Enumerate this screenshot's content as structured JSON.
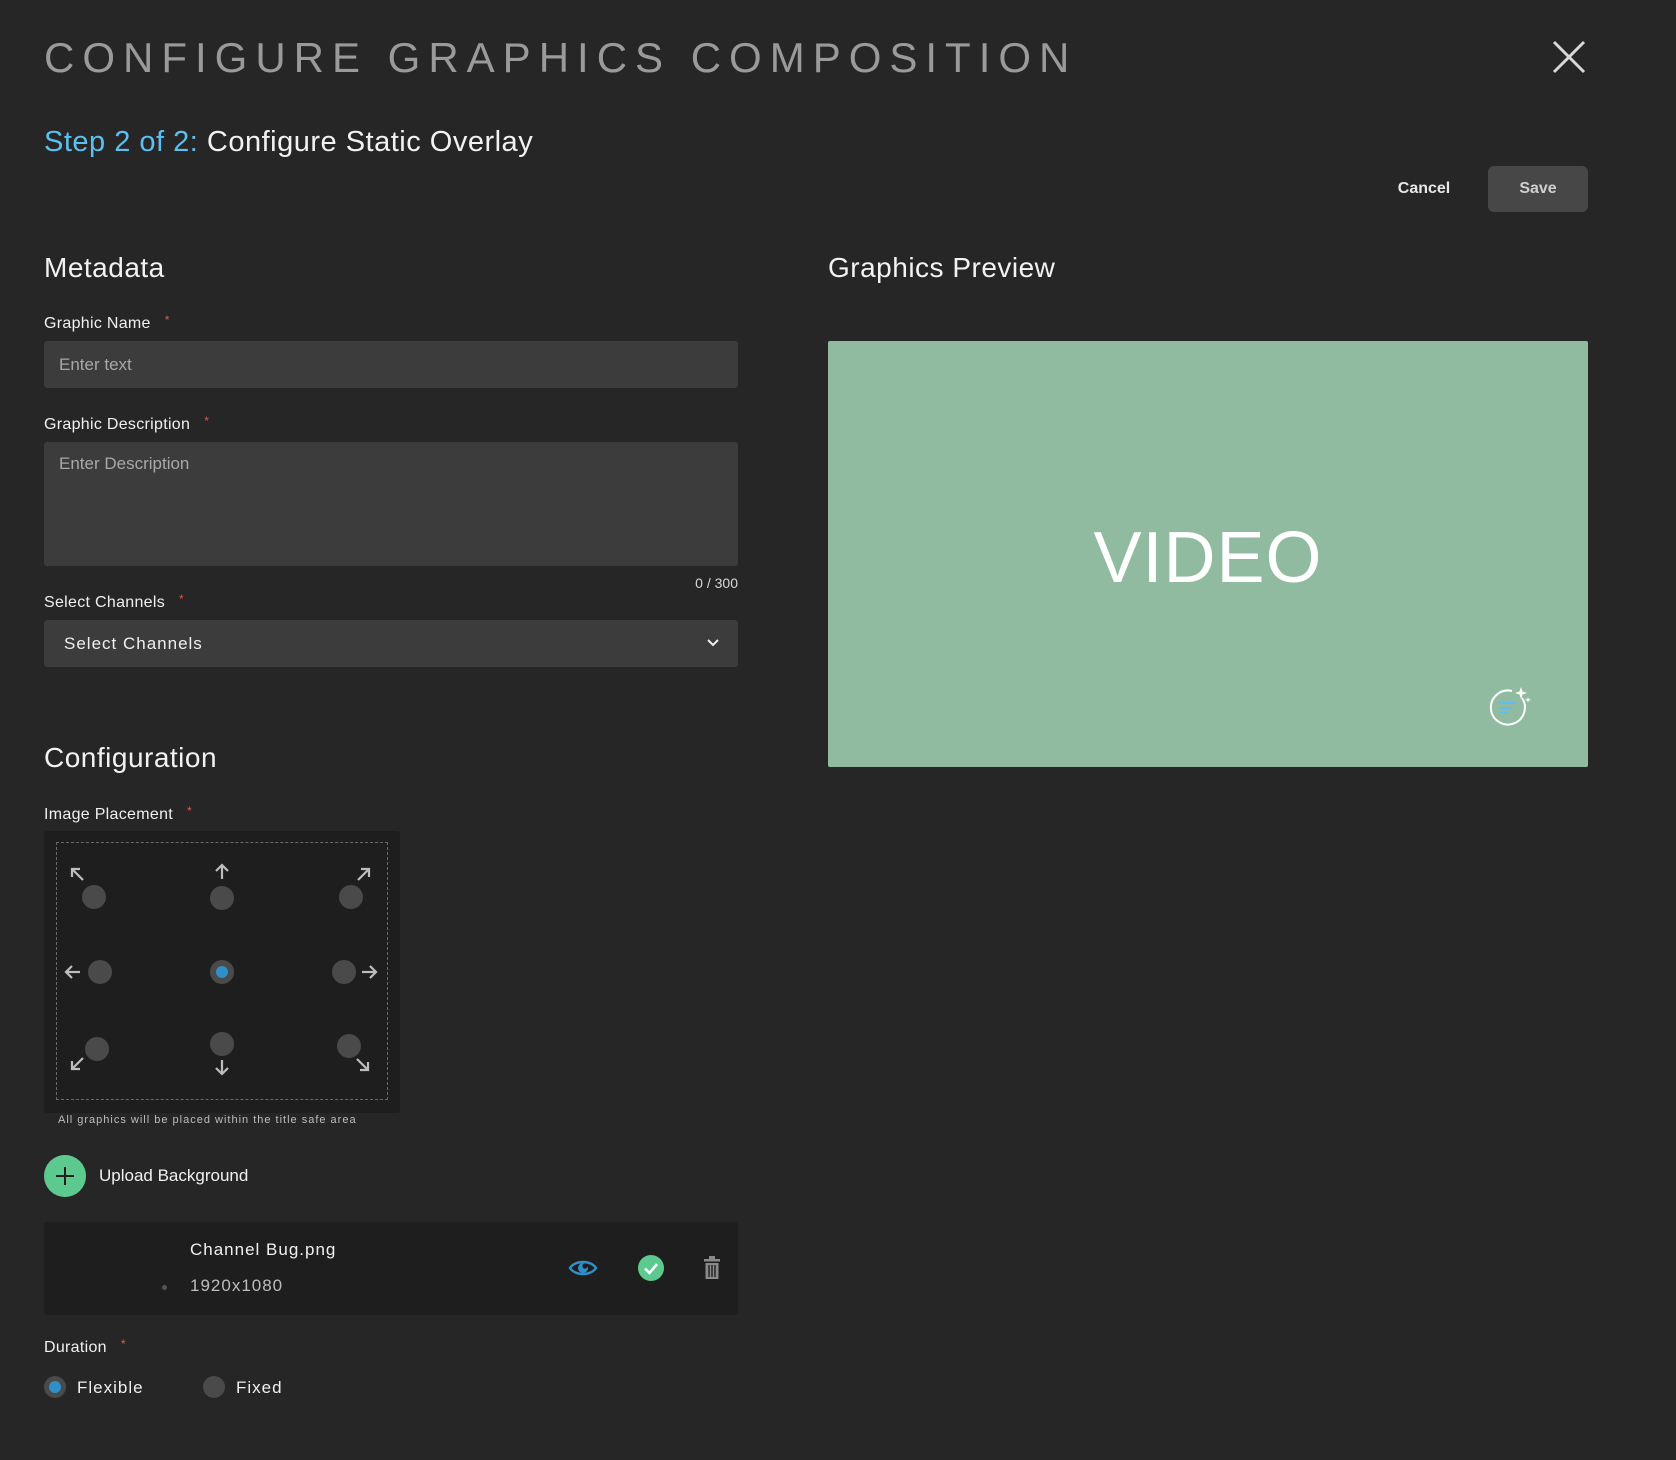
{
  "header": {
    "title": "CONFIGURE GRAPHICS COMPOSITION",
    "close_icon": "close-icon"
  },
  "step": {
    "number_label": "Step 2 of 2:",
    "title": "Configure Static Overlay"
  },
  "actions": {
    "cancel_label": "Cancel",
    "save_label": "Save"
  },
  "metadata": {
    "heading": "Metadata",
    "graphic_name": {
      "label": "Graphic Name",
      "required_mark": "*",
      "placeholder": "Enter text",
      "value": ""
    },
    "graphic_description": {
      "label": "Graphic Description",
      "required_mark": "*",
      "placeholder": "Enter Description",
      "value": "",
      "counter": "0 / 300"
    },
    "channels": {
      "label": "Select Channels",
      "required_mark": "*",
      "selected": "Select Channels",
      "icon": "chevron-down-icon"
    }
  },
  "configuration": {
    "heading": "Configuration",
    "image_placement": {
      "label": "Image Placement",
      "required_mark": "*",
      "positions": [
        "top-left",
        "top-center",
        "top-right",
        "middle-left",
        "center",
        "middle-right",
        "bottom-left",
        "bottom-center",
        "bottom-right"
      ],
      "selected": "center",
      "note": "All graphics will be placed within the title safe area"
    },
    "upload": {
      "label": "Upload Background",
      "icon": "plus-icon"
    },
    "file": {
      "name": "Channel Bug.png",
      "dimensions": "1920x1080",
      "icons": [
        "eye-icon",
        "check-circle-icon",
        "trash-icon"
      ]
    },
    "duration": {
      "label": "Duration",
      "required_mark": "*",
      "options": [
        "Flexible",
        "Fixed"
      ],
      "selected": "Flexible"
    }
  },
  "preview": {
    "heading": "Graphics Preview",
    "placeholder_text": "VIDEO",
    "background_color": "#91bba0",
    "icon": "ai-sparkle-icon"
  },
  "colors": {
    "background": "#262626",
    "accent_blue": "#5bc0ef",
    "selected_radio": "#2f8fc9",
    "success_green": "#5cc98f",
    "required_red": "#e05a4a"
  }
}
